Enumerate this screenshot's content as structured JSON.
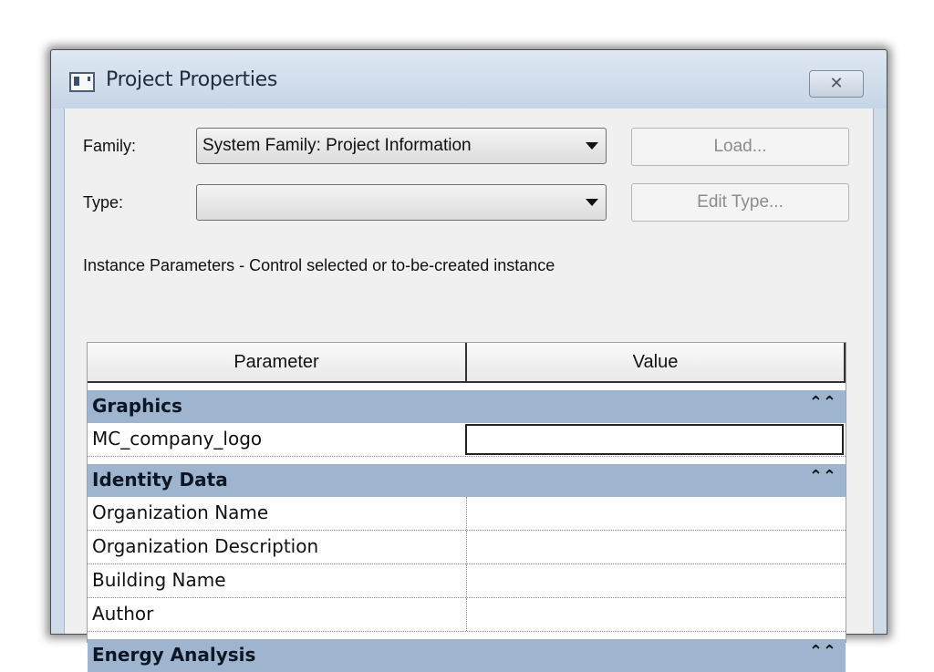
{
  "window": {
    "title": "Project Properties",
    "close_glyph": "✕"
  },
  "family": {
    "label": "Family:",
    "value": "System Family: Project Information",
    "load_label": "Load..."
  },
  "type": {
    "label": "Type:",
    "value": "",
    "edit_type_label": "Edit Type..."
  },
  "instance_caption": "Instance Parameters - Control selected or to-be-created instance",
  "grid": {
    "headers": {
      "parameter": "Parameter",
      "value": "Value"
    },
    "groups": [
      {
        "name": "Graphics",
        "collapse_glyph": "⌃⌃",
        "rows": [
          {
            "name": "MC_company_logo",
            "value": ""
          }
        ]
      },
      {
        "name": "Identity Data",
        "collapse_glyph": "⌃⌃",
        "rows": [
          {
            "name": "Organization Name",
            "value": ""
          },
          {
            "name": "Organization Description",
            "value": ""
          },
          {
            "name": "Building Name",
            "value": ""
          },
          {
            "name": "Author",
            "value": ""
          }
        ]
      },
      {
        "name": "Energy Analysis",
        "collapse_glyph": "⌃⌃",
        "rows": []
      }
    ]
  },
  "icons": {
    "window_icon": "window-icon",
    "close": "close-icon",
    "dropdown": "chevron-down-icon",
    "collapse": "collapse-icon"
  },
  "colors": {
    "group_header_bg": "#9fb4cf",
    "title_bar": "#cfdbe9",
    "client_bg": "#f0f0f0"
  }
}
